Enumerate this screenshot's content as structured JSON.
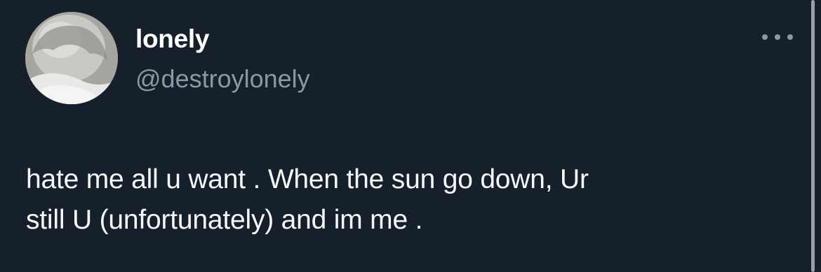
{
  "tweet": {
    "author": {
      "display_name": "lonely",
      "handle": "@destroylonely",
      "avatar_icon": "profile-photo"
    },
    "more_icon": "ellipsis-horizontal-icon",
    "text_line_1": "hate me all u want . When the sun go down, Ur",
    "text_line_2": "still U (unfortunately) and im me ."
  },
  "colors": {
    "background": "#15202b",
    "primary_text": "#f7f9f9",
    "secondary_text": "#8b98a5",
    "scrollbar": "#9aa0a6"
  }
}
